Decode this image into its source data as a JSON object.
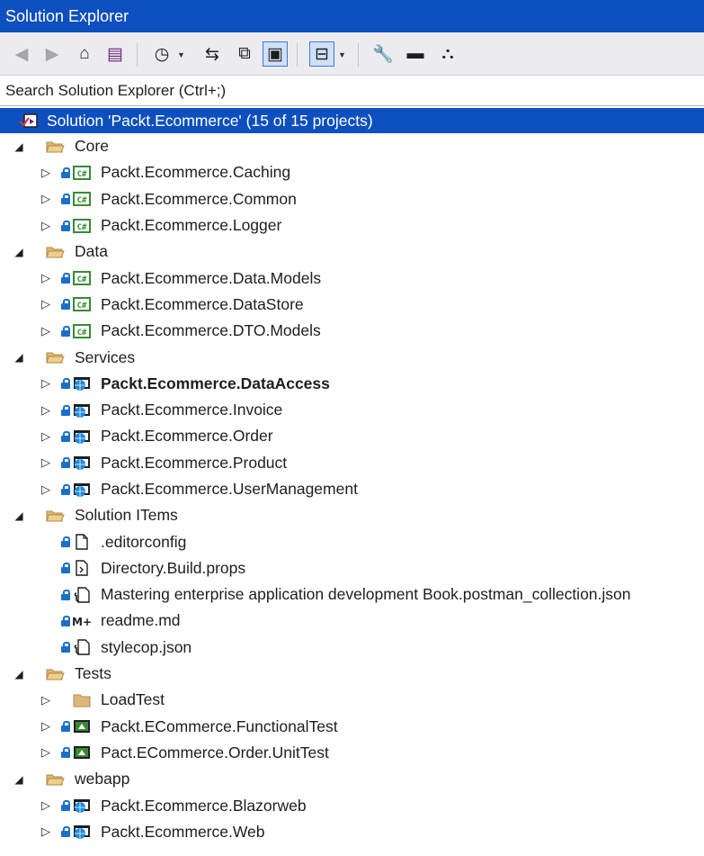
{
  "window": {
    "title": "Solution Explorer"
  },
  "toolbar": {
    "buttons": [
      {
        "icon": "back-icon",
        "glyph": "◀"
      },
      {
        "icon": "forward-icon",
        "glyph": "▶"
      },
      {
        "icon": "home-icon",
        "glyph": "⌂"
      },
      {
        "icon": "switch-views-icon",
        "glyph": "▤"
      },
      {
        "icon": "pending-changes-filter-icon",
        "glyph": "◷"
      },
      {
        "icon": "sync-with-active-document-icon",
        "glyph": "⇆"
      },
      {
        "icon": "refresh-icon",
        "glyph": "⧉"
      },
      {
        "icon": "show-all-files-icon",
        "glyph": "▣"
      },
      {
        "icon": "collapse-all-icon",
        "glyph": "⊟"
      },
      {
        "icon": "properties-icon",
        "glyph": "🔧"
      },
      {
        "icon": "preview-selected-items-icon",
        "glyph": "▬"
      },
      {
        "icon": "class-view-icon",
        "glyph": "⛬"
      }
    ]
  },
  "search": {
    "placeholder": "Search Solution Explorer (Ctrl+;)"
  },
  "tree": [
    {
      "label": "Solution 'Packt.Ecommerce' (15 of 15 projects)",
      "level": 0,
      "type": "solution",
      "expander": "",
      "lock": false,
      "selected": true
    },
    {
      "label": "Core",
      "level": 1,
      "type": "folder",
      "expander": "expanded",
      "lock": false
    },
    {
      "label": "Packt.Ecommerce.Caching",
      "level": 2,
      "type": "csproj",
      "expander": "collapsed",
      "lock": true
    },
    {
      "label": "Packt.Ecommerce.Common",
      "level": 2,
      "type": "csproj",
      "expander": "collapsed",
      "lock": true
    },
    {
      "label": "Packt.Ecommerce.Logger",
      "level": 2,
      "type": "csproj",
      "expander": "collapsed",
      "lock": true
    },
    {
      "label": "Data",
      "level": 1,
      "type": "folder",
      "expander": "expanded",
      "lock": false
    },
    {
      "label": "Packt.Ecommerce.Data.Models",
      "level": 2,
      "type": "csproj",
      "expander": "collapsed",
      "lock": true
    },
    {
      "label": "Packt.Ecommerce.DataStore",
      "level": 2,
      "type": "csproj",
      "expander": "collapsed",
      "lock": true
    },
    {
      "label": "Packt.Ecommerce.DTO.Models",
      "level": 2,
      "type": "csproj",
      "expander": "collapsed",
      "lock": true
    },
    {
      "label": "Services",
      "level": 1,
      "type": "folder",
      "expander": "expanded",
      "lock": false
    },
    {
      "label": "Packt.Ecommerce.DataAccess",
      "level": 2,
      "type": "webproj",
      "expander": "collapsed",
      "lock": true,
      "bold": true
    },
    {
      "label": "Packt.Ecommerce.Invoice",
      "level": 2,
      "type": "webproj",
      "expander": "collapsed",
      "lock": true
    },
    {
      "label": "Packt.Ecommerce.Order",
      "level": 2,
      "type": "webproj",
      "expander": "collapsed",
      "lock": true
    },
    {
      "label": "Packt.Ecommerce.Product",
      "level": 2,
      "type": "webproj",
      "expander": "collapsed",
      "lock": true
    },
    {
      "label": "Packt.Ecommerce.UserManagement",
      "level": 2,
      "type": "webproj",
      "expander": "collapsed",
      "lock": true
    },
    {
      "label": "Solution ITems",
      "level": 1,
      "type": "folder",
      "expander": "expanded",
      "lock": false
    },
    {
      "label": ".editorconfig",
      "level": 2,
      "type": "file",
      "expander": "",
      "lock": true
    },
    {
      "label": "Directory.Build.props",
      "level": 2,
      "type": "propsfile",
      "expander": "",
      "lock": true
    },
    {
      "label": "Mastering enterprise application development Book.postman_collection.json",
      "level": 2,
      "type": "jsonfile",
      "expander": "",
      "lock": true
    },
    {
      "label": "readme.md",
      "level": 2,
      "type": "markdown",
      "expander": "",
      "lock": true
    },
    {
      "label": "stylecop.json",
      "level": 2,
      "type": "jsonfile",
      "expander": "",
      "lock": true
    },
    {
      "label": "Tests",
      "level": 1,
      "type": "folder",
      "expander": "expanded",
      "lock": false
    },
    {
      "label": "LoadTest",
      "level": 2,
      "type": "folder-closed",
      "expander": "collapsed",
      "lock": false
    },
    {
      "label": "Packt.ECommerce.FunctionalTest",
      "level": 2,
      "type": "testproj",
      "expander": "collapsed",
      "lock": true
    },
    {
      "label": "Pact.ECommerce.Order.UnitTest",
      "level": 2,
      "type": "testproj",
      "expander": "collapsed",
      "lock": true
    },
    {
      "label": "webapp",
      "level": 1,
      "type": "folder",
      "expander": "expanded",
      "lock": false
    },
    {
      "label": "Packt.Ecommerce.Blazorweb",
      "level": 2,
      "type": "webproj",
      "expander": "collapsed",
      "lock": true
    },
    {
      "label": "Packt.Ecommerce.Web",
      "level": 2,
      "type": "webproj",
      "expander": "collapsed",
      "lock": true
    }
  ]
}
